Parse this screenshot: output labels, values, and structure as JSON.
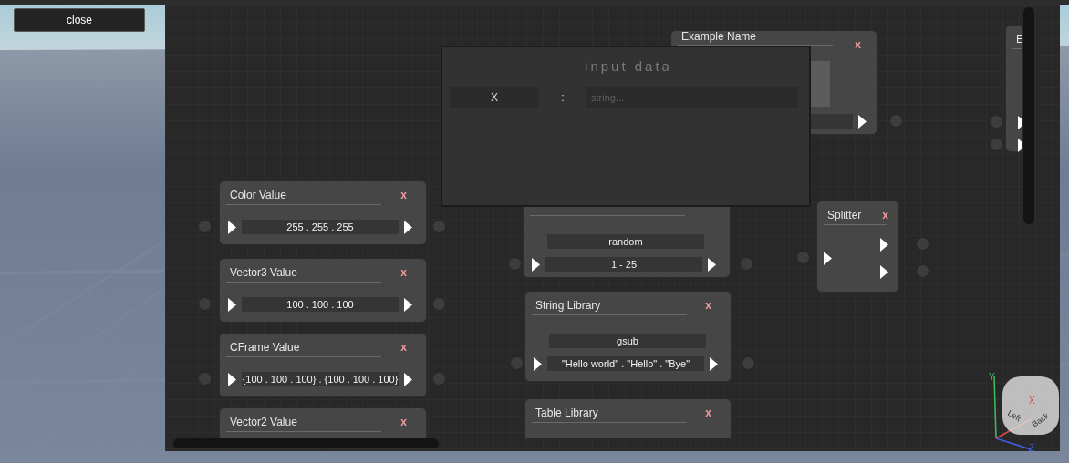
{
  "close_button": {
    "label": "close"
  },
  "editor": {
    "nodes": [
      {
        "kind": "preview",
        "title": "Example Name",
        "close": "x"
      },
      {
        "kind": "partial",
        "title": "E"
      },
      {
        "kind": "value",
        "title": "Color Value",
        "close": "x",
        "fields": [
          "255 . 255 . 255"
        ]
      },
      {
        "kind": "function",
        "fields": [
          "random",
          "1 - 25"
        ]
      },
      {
        "kind": "splitter",
        "title": "Splitter",
        "close": "x"
      },
      {
        "kind": "value",
        "title": "Vector3 Value",
        "close": "x",
        "fields": [
          "100 . 100 . 100"
        ]
      },
      {
        "kind": "function",
        "title": "String Library",
        "close": "x",
        "fields": [
          "gsub",
          "\"Hello world\" . \"Hello\" . \"Bye\""
        ]
      },
      {
        "kind": "value",
        "title": "CFrame Value",
        "close": "x",
        "fields": [
          "{100 . 100 . 100} . {100 . 100 . 100}"
        ]
      },
      {
        "kind": "value",
        "title": "Vector2 Value",
        "close": "x"
      },
      {
        "kind": "function",
        "title": "Table Library",
        "close": "x"
      }
    ],
    "dialog": {
      "title": "input data",
      "key": "X",
      "separator": ":",
      "placeholder": "string..."
    }
  },
  "gizmo": {
    "axes": [
      "Y",
      "X",
      "Z"
    ],
    "faces": [
      "Left",
      "Back"
    ]
  }
}
